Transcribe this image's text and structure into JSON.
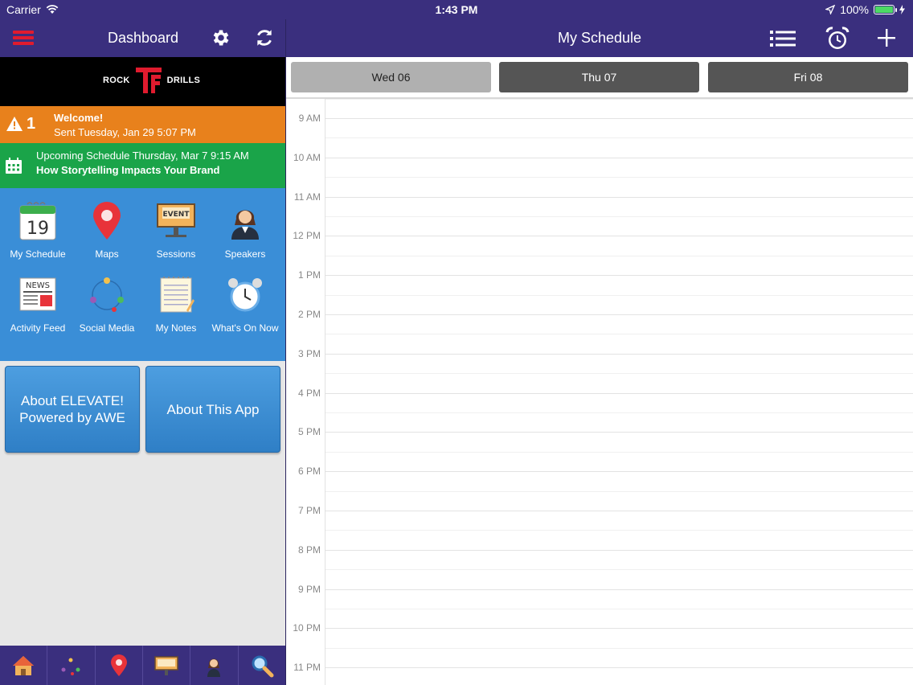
{
  "status": {
    "carrier": "Carrier",
    "time": "1:43 PM",
    "battery": "100%"
  },
  "left_nav": {
    "title": "Dashboard"
  },
  "right_nav": {
    "title": "My Schedule"
  },
  "logo": {
    "left_text": "ROCK",
    "right_text": "DRILLS"
  },
  "alert": {
    "count": "1",
    "title": "Welcome!",
    "subtitle": "Sent Tuesday, Jan 29 5:07 PM"
  },
  "upcoming": {
    "line1": "Upcoming Schedule Thursday, Mar 7 9:15 AM",
    "line2": "How Storytelling Impacts Your Brand"
  },
  "tiles": [
    {
      "label": "My Schedule",
      "icon": "calendar-icon",
      "date": "19"
    },
    {
      "label": "Maps",
      "icon": "map-pin-icon"
    },
    {
      "label": "Sessions",
      "icon": "event-sign-icon",
      "sign": "EVENT"
    },
    {
      "label": "Speakers",
      "icon": "speaker-person-icon"
    },
    {
      "label": "Activity Feed",
      "icon": "newspaper-icon",
      "sign": "NEWS"
    },
    {
      "label": "Social Media",
      "icon": "social-network-icon"
    },
    {
      "label": "My Notes",
      "icon": "notepad-icon"
    },
    {
      "label": "What's On Now",
      "icon": "alarm-clock-icon"
    }
  ],
  "buttons": {
    "about_event": "About ELEVATE! Powered by AWE",
    "about_app": "About This App"
  },
  "tabbar": [
    {
      "icon": "home-icon"
    },
    {
      "icon": "social-network-icon"
    },
    {
      "icon": "map-pin-icon"
    },
    {
      "icon": "event-sign-icon"
    },
    {
      "icon": "speaker-person-icon"
    },
    {
      "icon": "search-icon"
    }
  ],
  "days": [
    {
      "label": "Wed 06",
      "active": true
    },
    {
      "label": "Thu 07",
      "active": false
    },
    {
      "label": "Fri 08",
      "active": false
    }
  ],
  "hours": [
    "9 AM",
    "10 AM",
    "11 AM",
    "12 PM",
    "1 PM",
    "2 PM",
    "3 PM",
    "4 PM",
    "5 PM",
    "6 PM",
    "7 PM",
    "8 PM",
    "9 PM",
    "10 PM",
    "11 PM"
  ],
  "colors": {
    "navbar": "#3a2f7e",
    "alert": "#e8811c",
    "upcoming": "#1aa449",
    "grid": "#3a8ed7",
    "brand_red": "#e01b2e"
  }
}
